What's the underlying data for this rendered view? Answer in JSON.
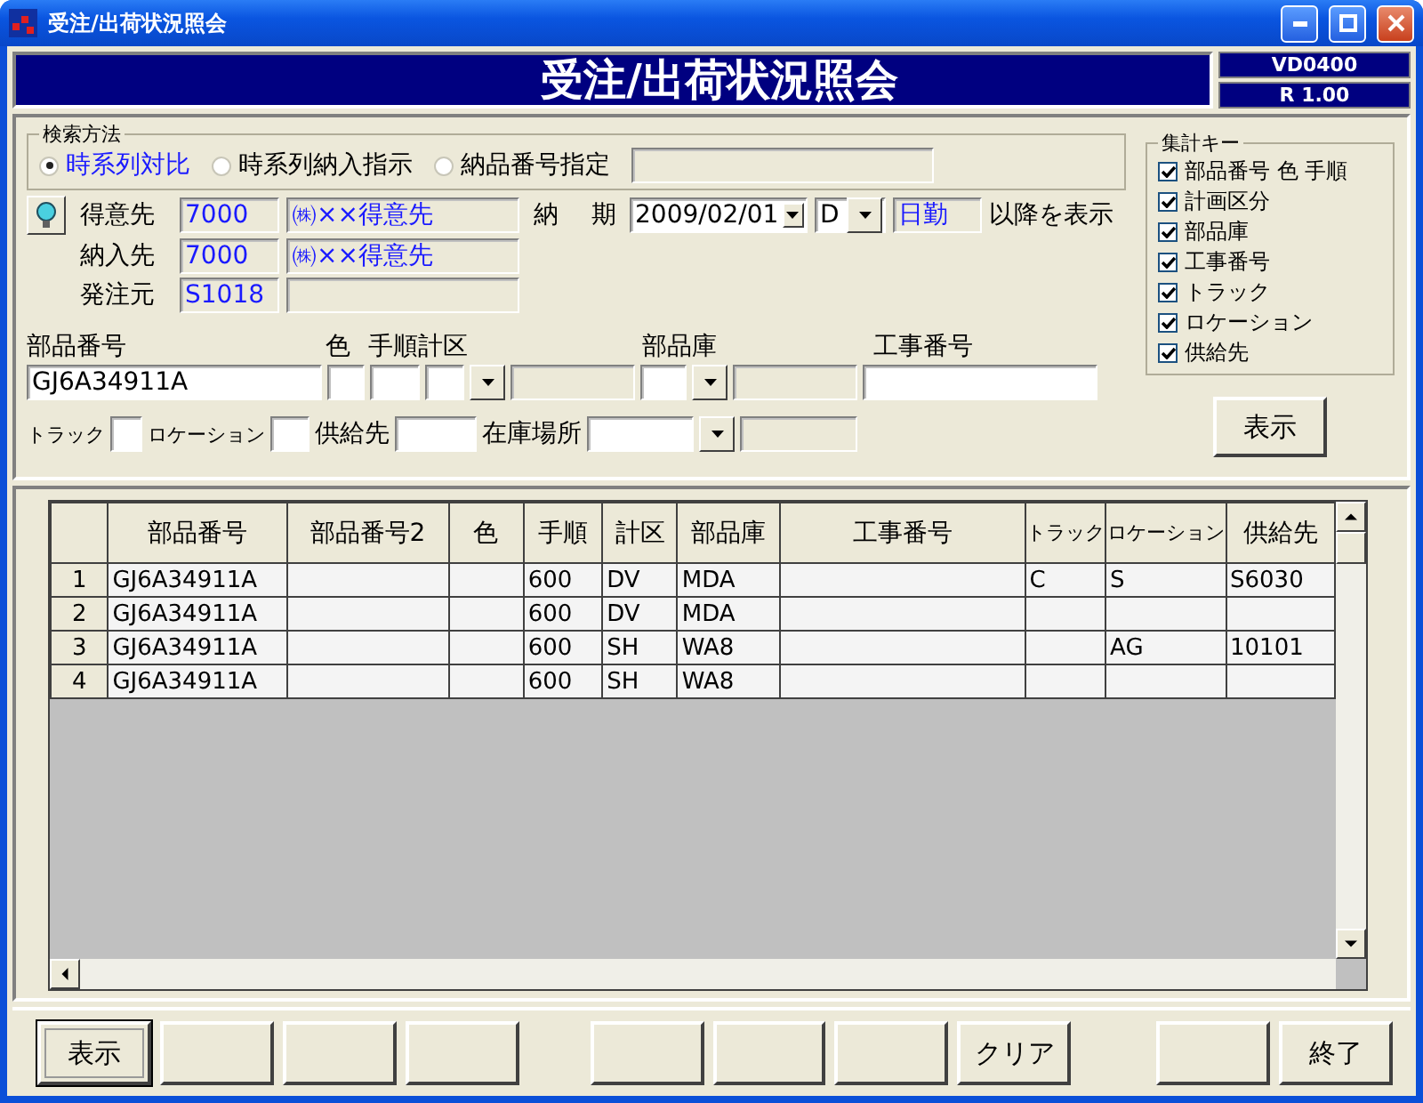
{
  "window": {
    "title": "受注/出荷状況照会"
  },
  "header": {
    "title": "受注/出荷状況照会",
    "code": "VD0400",
    "revision": "R 1.00"
  },
  "search_method": {
    "legend": "検索方法",
    "options": [
      {
        "label": "時系列対比",
        "selected": true
      },
      {
        "label": "時系列納入指示",
        "selected": false
      },
      {
        "label": "納品番号指定",
        "selected": false
      }
    ]
  },
  "parties": [
    {
      "label": "得意先",
      "code": "7000",
      "name": "㈱××得意先"
    },
    {
      "label": "納入先",
      "code": "7000",
      "name": "㈱××得意先"
    },
    {
      "label": "発注元",
      "code": "S1018"
    }
  ],
  "due": {
    "label": "納 期",
    "date": "2009/02/01",
    "unit": "D",
    "shift": "日勤",
    "suffix": "以降を表示"
  },
  "filters": {
    "part_number": {
      "label": "部品番号",
      "value": "GJ6A34911A"
    },
    "color": {
      "label": "色"
    },
    "procedure": {
      "label": "手順"
    },
    "plan_class": {
      "label": "計区"
    },
    "warehouse": {
      "label": "部品庫"
    },
    "work_number": {
      "label": "工事番号"
    },
    "track": {
      "label": "トラック"
    },
    "location": {
      "label": "ロケーション"
    },
    "supplier": {
      "label": "供給先"
    },
    "stock_place": {
      "label": "在庫場所"
    }
  },
  "aggregate_keys": {
    "legend": "集計キー",
    "items": [
      {
        "label": "部品番号 色 手順",
        "checked": true
      },
      {
        "label": "計画区分",
        "checked": true
      },
      {
        "label": "部品庫",
        "checked": true
      },
      {
        "label": "工事番号",
        "checked": true
      },
      {
        "label": "トラック",
        "checked": true
      },
      {
        "label": "ロケーション",
        "checked": true
      },
      {
        "label": "供給先",
        "checked": true
      }
    ]
  },
  "show_button": "表示",
  "table": {
    "columns": [
      "部品番号",
      "部品番号2",
      "色",
      "手順",
      "計区",
      "部品庫",
      "工事番号",
      "トラック",
      "ロケーション",
      "供給先"
    ],
    "rows": [
      {
        "number": "1",
        "cells": [
          "GJ6A34911A",
          null,
          null,
          "600",
          "DV",
          "MDA",
          null,
          "C",
          "S",
          "S6030"
        ]
      },
      {
        "number": "2",
        "cells": [
          "GJ6A34911A",
          null,
          null,
          "600",
          "DV",
          "MDA",
          null,
          null,
          null,
          null
        ]
      },
      {
        "number": "3",
        "cells": [
          "GJ6A34911A",
          null,
          null,
          "600",
          "SH",
          "WA8",
          null,
          null,
          "AG",
          "10101"
        ]
      },
      {
        "number": "4",
        "cells": [
          "GJ6A34911A",
          null,
          null,
          "600",
          "SH",
          "WA8",
          null,
          null,
          null,
          null
        ]
      }
    ]
  },
  "function_keys": [
    {
      "label": "表示",
      "focused": true
    },
    {
      "focused": false
    },
    {
      "focused": false
    },
    {
      "focused": false
    },
    {
      "focused": false
    },
    {
      "focused": false
    },
    {
      "focused": false
    },
    {
      "label": "クリア",
      "focused": false
    },
    {
      "focused": false
    },
    {
      "label": "終了",
      "focused": false
    }
  ]
}
